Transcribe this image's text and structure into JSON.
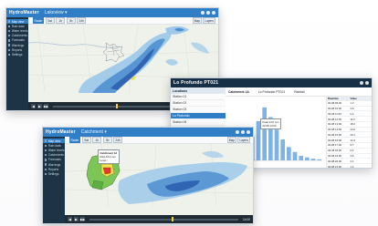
{
  "window_main": {
    "app_name": "HydroMaster",
    "app_sub": "Lakeview ▾",
    "sidebar": [
      {
        "label": "Map view",
        "active": true
      },
      {
        "label": "Rain data"
      },
      {
        "label": "Water levels"
      },
      {
        "label": "Catchments"
      },
      {
        "label": "Forecasts"
      },
      {
        "label": "Warnings"
      },
      {
        "label": "Reports"
      },
      {
        "label": "Settings"
      }
    ],
    "toolbar": [
      "Radar",
      "Sat",
      "1h",
      "3h",
      "24h",
      "Map",
      "Layers"
    ],
    "timeline": {
      "play": "▶",
      "back": "◀",
      "fwd": "▶▶",
      "time": "12:30",
      "progress": 0.42
    }
  },
  "window_chart": {
    "app_name": "Lo Profundo PT021",
    "info_fields": [
      "Catchment 1A",
      "Lo Profundo PT021",
      "Rainfall"
    ],
    "left_panel": {
      "header": "Locations",
      "rows": [
        "Station 01",
        "Station 02",
        "Station 03",
        "Lo Profundo",
        "Station 05",
        "Station 06",
        "Station 07",
        "Station 08",
        "Station 09",
        "Station 10"
      ],
      "selected_index": 3
    },
    "tooltip": [
      "Peak 24.6 mm",
      "02-08 14:00"
    ],
    "table_headers": [
      "Datetime",
      "Value"
    ],
    "table_rows": [
      [
        "02-08 09:00",
        "1.2"
      ],
      [
        "02-08 10:00",
        "3.8"
      ],
      [
        "02-08 11:00",
        "6.4"
      ],
      [
        "02-08 12:00",
        "11.0"
      ],
      [
        "02-08 13:00",
        "18.2"
      ],
      [
        "02-08 14:00",
        "24.6"
      ],
      [
        "02-08 15:00",
        "20.1"
      ],
      [
        "02-08 16:00",
        "14.3"
      ],
      [
        "02-08 17:00",
        "9.7"
      ],
      [
        "02-08 18:00",
        "6.2"
      ],
      [
        "02-08 19:00",
        "3.9"
      ],
      [
        "02-08 20:00",
        "2.1"
      ],
      [
        "02-08 21:00",
        "1.4"
      ],
      [
        "02-08 22:00",
        "0.8"
      ],
      [
        "02-08 23:00",
        "0.5"
      ]
    ]
  },
  "window_catchment": {
    "app_name": "HydroMaster",
    "app_sub": "Catchment ▾",
    "sidebar": [
      {
        "label": "Map view",
        "active": true
      },
      {
        "label": "Rain data"
      },
      {
        "label": "Water levels"
      },
      {
        "label": "Catchments"
      },
      {
        "label": "Forecasts"
      },
      {
        "label": "Warnings"
      },
      {
        "label": "Reports"
      },
      {
        "label": "Settings"
      }
    ],
    "toolbar": [
      "Radar",
      "Sat",
      "1h",
      "3h",
      "24h",
      "Map",
      "Layers"
    ],
    "popup": [
      "Catchment 1A",
      "Rain 18.4 mm",
      "Level ↑"
    ],
    "timeline": {
      "play": "▶",
      "back": "◀",
      "fwd": "▶▶",
      "time": "14:00",
      "progress": 0.55
    }
  },
  "colors": {
    "accent": "#2f7ec6",
    "sidebar_bg": "#1d3447",
    "radar_light": "#9ec9ea",
    "radar_mid": "#4f8fd0",
    "radar_strong": "#2b5fb0",
    "catchment_green": "#7cc557",
    "catchment_yellow": "#f0e04a",
    "catchment_red": "#e23a2e"
  }
}
